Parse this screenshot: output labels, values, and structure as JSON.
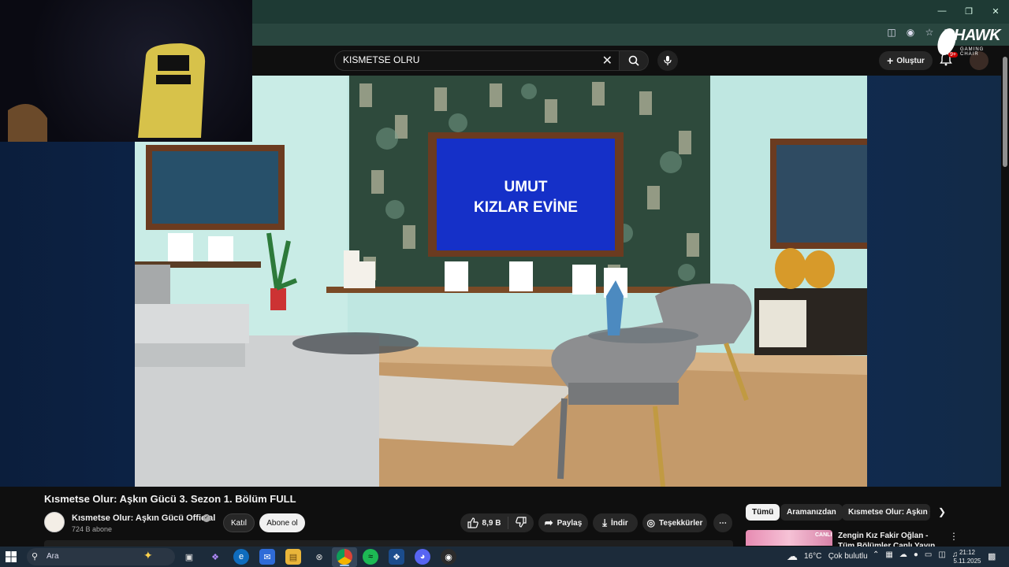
{
  "search": {
    "value": "KISMETSE OLRU"
  },
  "header": {
    "create_label": "Oluştur",
    "notif_count": "9+"
  },
  "overlay_logo": {
    "name": "HAWK",
    "sub": "GAMING CHAIR"
  },
  "video_frame": {
    "tv_line1": "UMUT",
    "tv_line2": "KIZLAR EVİNE"
  },
  "video": {
    "title": "Kısmetse Olur: Aşkın Gücü 3. Sezon 1. Bölüm FULL",
    "channel": "Kısmetse Olur: Aşkın Gücü Official",
    "subscribers": "724 B abone",
    "join_label": "Katıl",
    "subscribe_label": "Abone ol",
    "likes": "8,9 B",
    "share_label": "Paylaş",
    "download_label": "İndir",
    "thanks_label": "Teşekkürler"
  },
  "chips": {
    "all": "Tümü",
    "from": "Aramanızdan",
    "related": "Kısmetse Olur: Aşkın Gücü"
  },
  "recommendation": {
    "live_badge": "CANLI",
    "title": "Zengin Kız Fakir Oğlan - Tüm Bölümler Canlı Yayın"
  },
  "taskbar": {
    "search_label": "Ara",
    "temperature": "16°C",
    "weather": "Çok bulutlu",
    "time": "21:12",
    "date": "5.11.2025"
  },
  "colors": {
    "titlebar": "#1e3a34",
    "accent_green": "#1DB954",
    "youtube_bg": "#0f0f0f"
  }
}
